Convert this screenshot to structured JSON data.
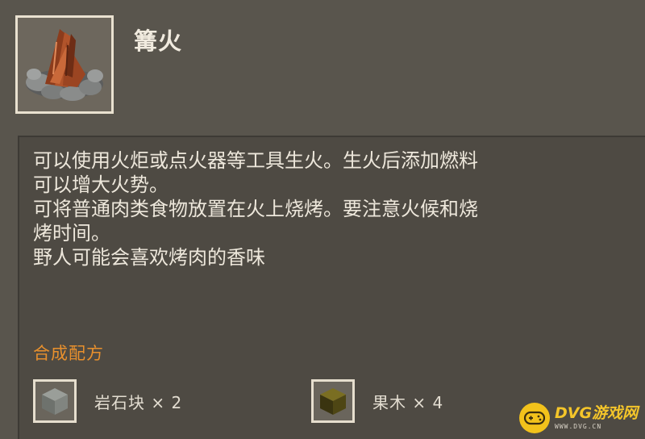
{
  "item": {
    "name": "篝火",
    "icon": "campfire-icon"
  },
  "description": {
    "lines": [
      "可以使用火炬或点火器等工具生火。生火后添加燃料",
      "可以增大火势。",
      "可将普通肉类食物放置在火上烧烤。要注意火候和烧",
      "烤时间。",
      "野人可能会喜欢烤肉的香味"
    ]
  },
  "recipe": {
    "title": "合成配方",
    "ingredients": [
      {
        "name": "岩石块",
        "quantity": "× 2",
        "icon": "stone-block-icon",
        "color": "#7c807b"
      },
      {
        "name": "果木",
        "quantity": "× 4",
        "icon": "fruitwood-block-icon",
        "color": "#5f5618"
      }
    ]
  },
  "colors": {
    "background": "#59554d",
    "panel": "#4e4a43",
    "accent": "#e8902d",
    "text": "#ede7db"
  },
  "watermark": {
    "name": "DVG游戏网",
    "url": "WWW.DVG.CN",
    "icon": "gamepad-icon"
  }
}
